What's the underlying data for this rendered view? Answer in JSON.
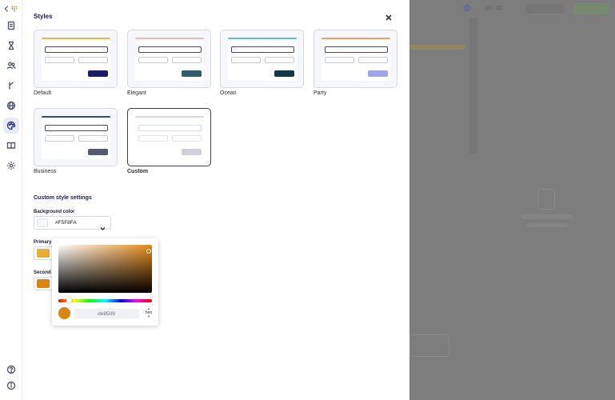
{
  "rail": {
    "top_icons": [
      "chevron-left-icon",
      "app-logo-icon"
    ],
    "items": [
      "document-icon",
      "hourglass-icon",
      "users-icon",
      "branch-icon",
      "globe-icon",
      "palette-icon",
      "book-icon",
      "settings-icon"
    ],
    "bottom_icons": [
      "help-icon",
      "info-icon"
    ]
  },
  "panel": {
    "title": "Styles",
    "close_icon": "close-icon",
    "styles": [
      {
        "name": "Default",
        "bar_color": "#E8B53A",
        "button_color": "#1A1A6E",
        "selected": false
      },
      {
        "name": "Elegant",
        "bar_color": "#F3B7A8",
        "button_color": "#2D5C6B",
        "selected": false
      },
      {
        "name": "Ocean",
        "bar_color": "#5BBBDC",
        "button_color": "#0F3947",
        "selected": false
      },
      {
        "name": "Party",
        "bar_color": "#F29F5C",
        "button_color": "#9FA6EE",
        "selected": false
      },
      {
        "name": "Business",
        "bar_color": "#245A60",
        "button_color": "#545B70",
        "selected": false
      },
      {
        "name": "Custom",
        "bar_color": "#D6D8E0",
        "button_color": "#CFD1D8",
        "selected": true
      }
    ],
    "custom_settings": {
      "title": "Custom style settings",
      "background_label": "Background color",
      "background_value": "#F5F8FA",
      "primary_label": "Primary",
      "primary_color": "#E8AE2E",
      "secondary_label": "Second",
      "secondary_color": "#DE8509"
    }
  },
  "color_picker": {
    "hex_value": "de8509",
    "mode": "hex",
    "color": "#DE8509"
  },
  "overlay": {
    "color": "#7D7D7D"
  }
}
